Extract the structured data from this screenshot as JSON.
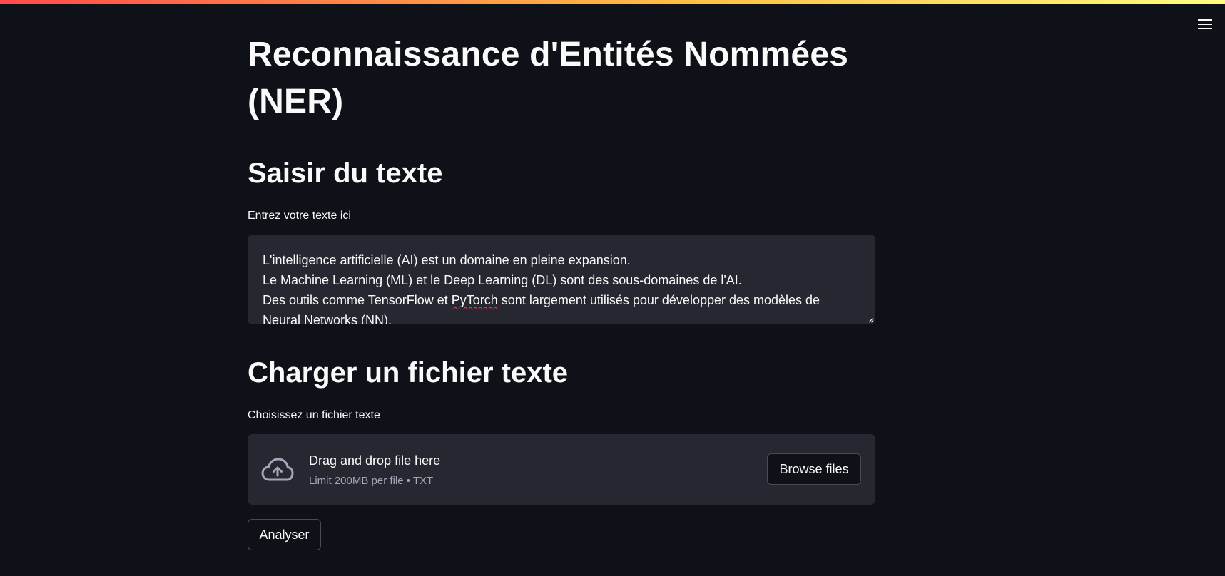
{
  "header": {
    "accent_gradient": [
      "#ff4b4b",
      "#ffbd45",
      "#fffd80"
    ],
    "menu_icon": "hamburger-menu-icon"
  },
  "main": {
    "title": "Reconnaissance d'Entités Nommées (NER)",
    "input_section": {
      "heading": "Saisir du texte",
      "label": "Entrez votre texte ici",
      "textarea_lines": [
        "L'intelligence artificielle (AI) est un domaine en pleine expansion.",
        "Le Machine Learning (ML) et le Deep Learning (DL) sont des sous-domaines de l'AI.",
        "Des outils comme TensorFlow et PyTorch sont largement utilisés pour développer des modèles de",
        "Neural Networks (NN)."
      ],
      "line3_before": "Des outils comme TensorFlow et ",
      "line3_flagged": "PyTorch",
      "line3_after": " sont largement utilisés pour développer des modèles de"
    },
    "upload_section": {
      "heading": "Charger un fichier texte",
      "label": "Choisissez un fichier texte",
      "dropzone_title": "Drag and drop file here",
      "dropzone_limit": "Limit 200MB per file • TXT",
      "browse_label": "Browse files",
      "upload_icon": "cloud-upload-icon"
    },
    "analyze_label": "Analyser"
  },
  "colors": {
    "background": "#0e1117",
    "surface": "#262730",
    "text": "#fafafa",
    "muted_text": "#a3a8b8"
  }
}
